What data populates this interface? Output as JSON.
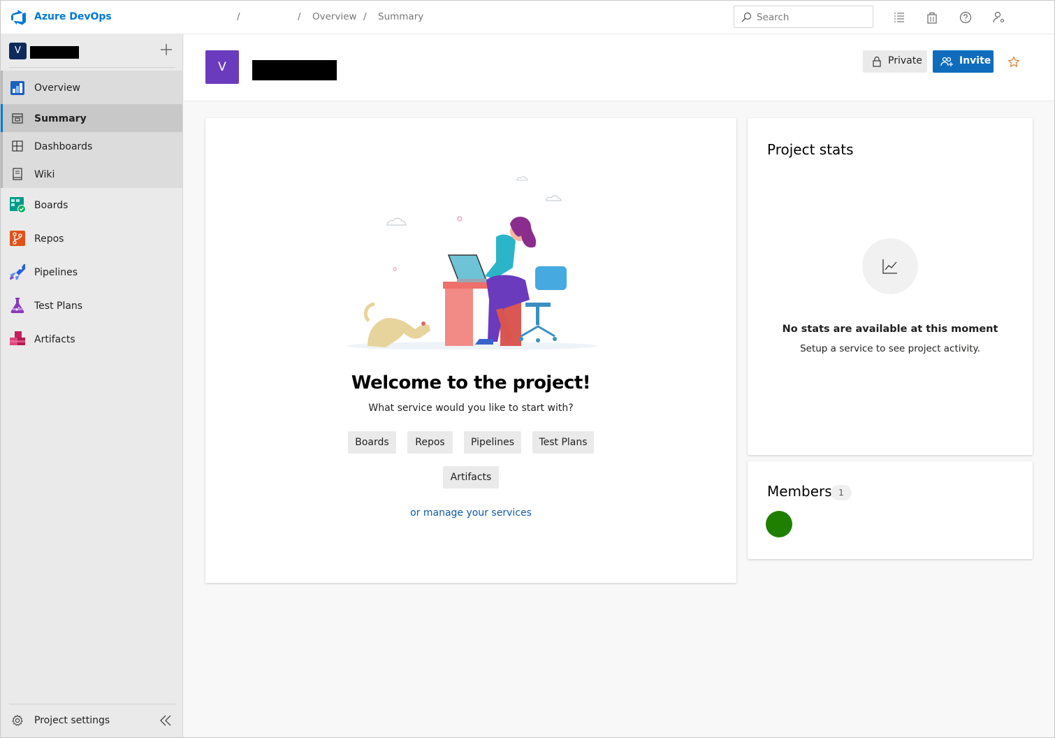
{
  "topbar": {
    "brand": "Azure DevOps",
    "breadcrumbs": [
      "/",
      "/",
      "Overview",
      "/",
      "Summary"
    ],
    "search_placeholder": "Search"
  },
  "sidebar": {
    "project_avatar_letter": "V",
    "items": [
      {
        "label": "Overview",
        "icon": "overview-icon"
      },
      {
        "label": "Summary",
        "icon": "summary-icon"
      },
      {
        "label": "Dashboards",
        "icon": "dashboards-icon"
      },
      {
        "label": "Wiki",
        "icon": "wiki-icon"
      },
      {
        "label": "Boards",
        "icon": "boards-icon"
      },
      {
        "label": "Repos",
        "icon": "repos-icon"
      },
      {
        "label": "Pipelines",
        "icon": "pipelines-icon"
      },
      {
        "label": "Test Plans",
        "icon": "test-plans-icon"
      },
      {
        "label": "Artifacts",
        "icon": "artifacts-icon"
      }
    ],
    "settings_label": "Project settings"
  },
  "header": {
    "avatar_letter": "V",
    "private_label": "Private",
    "invite_label": "Invite"
  },
  "welcome": {
    "title": "Welcome to the project!",
    "subtitle": "What service would you like to start with?",
    "services": [
      "Boards",
      "Repos",
      "Pipelines",
      "Test Plans",
      "Artifacts"
    ],
    "manage_link": "or manage your services"
  },
  "stats": {
    "title": "Project stats",
    "empty_title": "No stats are available at this moment",
    "empty_sub": "Setup a service to see project activity."
  },
  "members": {
    "title": "Members",
    "count": "1"
  },
  "colors": {
    "accent": "#0078d4",
    "invite_button": "#0f6cbd",
    "project_avatar": "#6b3bbe",
    "member_avatar": "#1f7f00"
  }
}
